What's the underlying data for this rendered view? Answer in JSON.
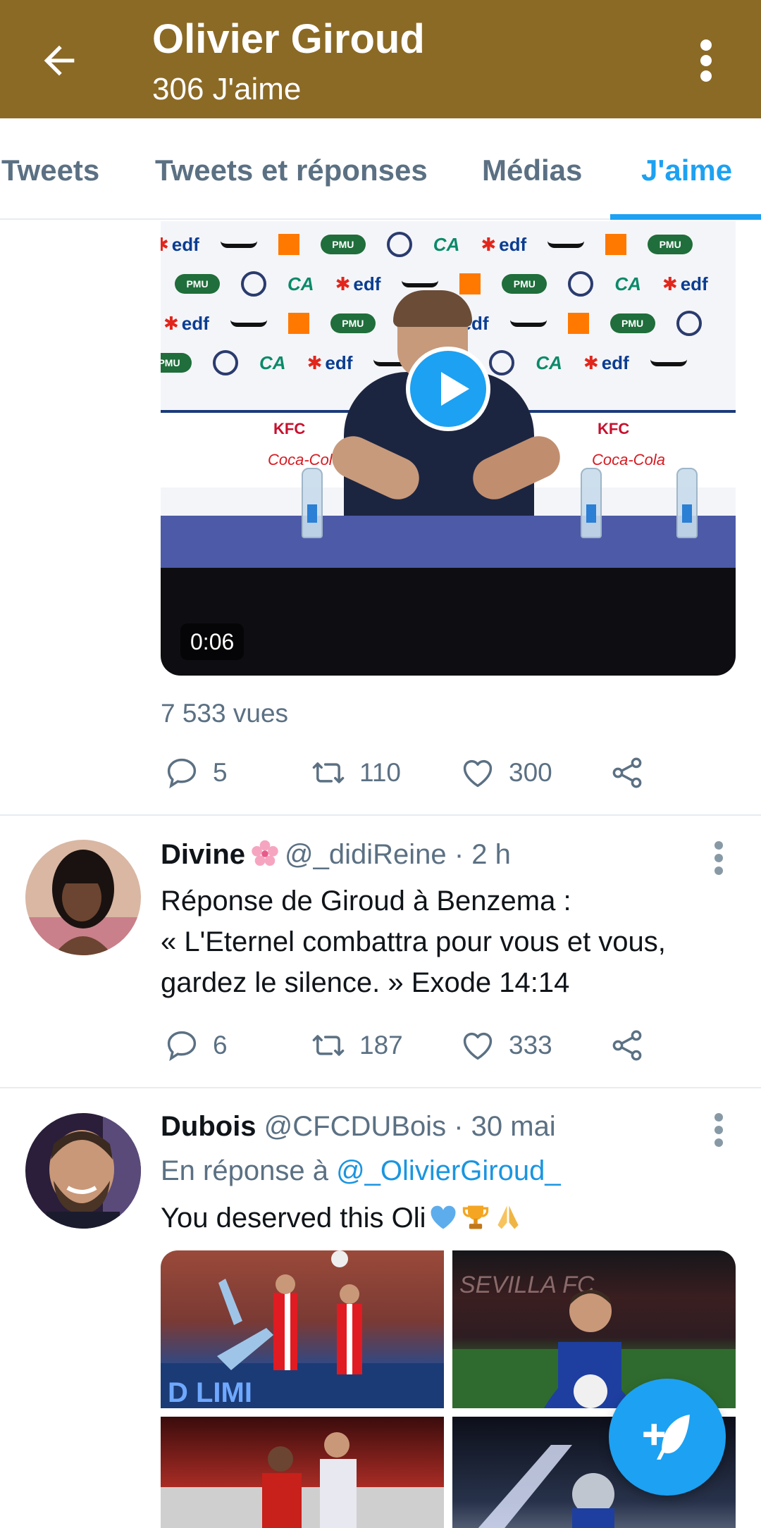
{
  "header": {
    "title": "Olivier Giroud",
    "subtitle": "306 J'aime",
    "background": "#8b6a26"
  },
  "tabs": [
    {
      "label": "Tweets",
      "active": false
    },
    {
      "label": "Tweets et réponses",
      "active": false
    },
    {
      "label": "Médias",
      "active": false
    },
    {
      "label": "J'aime",
      "active": true
    }
  ],
  "accent": "#1da1f2",
  "video_tweet": {
    "video": {
      "duration": "0:06",
      "wall": [
        "edf",
        "PMU",
        "edf",
        "PMU",
        "edf",
        "edf"
      ],
      "kfc": "KFC",
      "coke": "Coca-Cola"
    },
    "views": "7 533 vues",
    "replies": "5",
    "retweets": "110",
    "likes": "300"
  },
  "tweets": [
    {
      "name": "Divine",
      "handle": "@_didiReine",
      "time": "· 2 h",
      "lines": [
        "Réponse de Giroud à Benzema :",
        "« L'Eternel combattra pour vous et vous,",
        "gardez le silence. » Exode 14:14"
      ],
      "replies": "6",
      "retweets": "187",
      "likes": "333"
    },
    {
      "name": "Dubois",
      "handle": "@CFCDUBois",
      "time": "· 30 mai",
      "reply_prefix": "En réponse à",
      "reply_mention": "@_OlivierGiroud_",
      "text": "You deserved this Oli",
      "emojis": [
        "blue-heart",
        "trophy",
        "folded-hands"
      ]
    }
  ],
  "icons": [
    "back-arrow-icon",
    "more-vert-icon",
    "reply-icon",
    "retweet-icon",
    "like-icon",
    "share-icon",
    "compose-icon"
  ]
}
